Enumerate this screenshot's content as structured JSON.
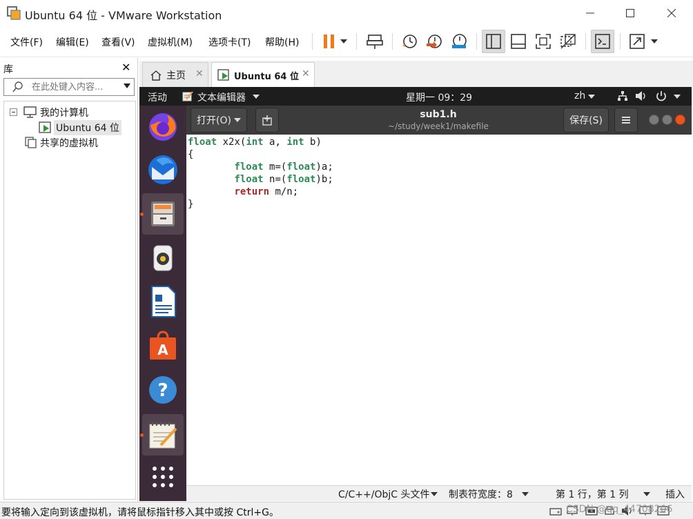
{
  "window": {
    "title": "Ubuntu 64 位 - VMware Workstation"
  },
  "menu": {
    "file": "文件(F)",
    "edit": "编辑(E)",
    "view": "查看(V)",
    "vm": "虚拟机(M)",
    "tabs": "选项卡(T)",
    "help": "帮助(H)"
  },
  "library": {
    "title": "库",
    "search_placeholder": "在此处键入内容...",
    "tree": {
      "my_computer": "我的计算机",
      "vm": "Ubuntu 64 位",
      "shared": "共享的虚拟机"
    }
  },
  "tabs": [
    {
      "label": "主页"
    },
    {
      "label": "Ubuntu 64 位"
    }
  ],
  "ubuntu": {
    "activities": "活动",
    "app_menu": "文本编辑器",
    "clock": "星期一 09：29",
    "input_method": "zh",
    "tooltip": "文件",
    "gedit": {
      "open_label": "打开(O)",
      "filename": "sub1.h",
      "path": "~/study/week1/makefile",
      "save_label": "保存(S)",
      "code": [
        "float x2x(int a, int b)",
        "{",
        "        float m=(float)a;",
        "        float n=(float)b;",
        "        return m/n;",
        "}"
      ],
      "status": {
        "language": "C/C++/ObjC 头文件",
        "tab_width": "制表符宽度：8",
        "position": "第 1 行，第 1 列",
        "mode": "插入"
      }
    }
  },
  "host_status": {
    "message": "要将输入定向到该虚拟机，请将鼠标指针移入其中或按 Ctrl+G。",
    "watermark": "CSDN @qq_44708206"
  },
  "colors": {
    "pause_orange": "#f07b1b",
    "ubuntu_orange": "#e95420",
    "dock_bg": "#3b2a37"
  }
}
